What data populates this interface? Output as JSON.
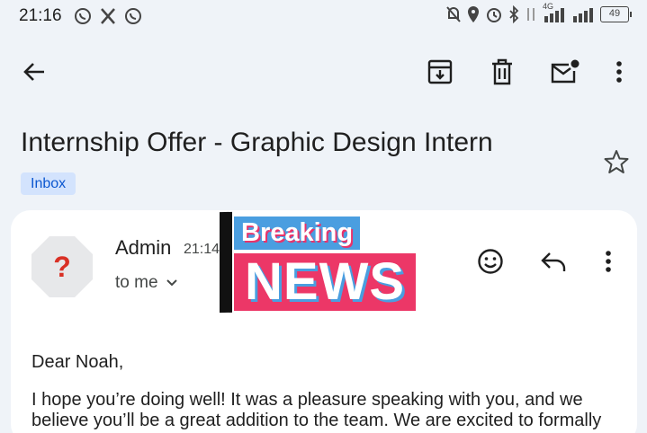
{
  "status_bar": {
    "time": "21:16",
    "battery": "49",
    "network": "4G"
  },
  "toolbar": {
    "back_icon": "arrow-back-icon",
    "archive_icon": "archive-icon",
    "delete_icon": "trash-icon",
    "mark_unread_icon": "mail-unread-icon",
    "more_icon": "more-vert-icon"
  },
  "email": {
    "subject": "Internship Offer - Graphic Design Intern",
    "label": "Inbox",
    "sender": "Admin",
    "time": "21:14",
    "recipient": "to me",
    "greeting": "Dear Noah,",
    "body_line1": "I hope you’re doing well! It was a pleasure speaking with you, and we",
    "body_line2": "believe you’ll be a great addition to the team. We are excited to formally"
  },
  "overlay": {
    "breaking": "Breaking",
    "news": "NEWS"
  },
  "colors": {
    "background": "#eff3f8",
    "card": "#ffffff",
    "chip_bg": "#d3e3fd",
    "chip_text": "#0b57d0",
    "news_pink": "#ec3767",
    "news_blue": "#4a9ee0"
  }
}
